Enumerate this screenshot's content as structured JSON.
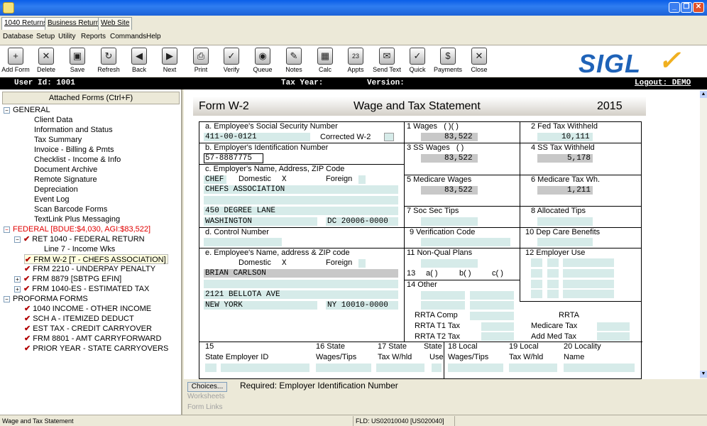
{
  "window": {
    "minimize": "_",
    "restore": "❐",
    "close": "✕"
  },
  "tabs": [
    "1040 Returns",
    "Business Returns",
    "Web Site"
  ],
  "menu": [
    "Database",
    "Setup",
    "Utility",
    "Reports",
    "Commands",
    "Help"
  ],
  "toolbar": [
    {
      "label": "Add Form",
      "icon": "add-form-icon",
      "glyph": "+"
    },
    {
      "label": "Delete",
      "icon": "delete-icon",
      "glyph": "✕"
    },
    {
      "label": "Save",
      "icon": "save-icon",
      "glyph": "▣"
    },
    {
      "label": "Refresh",
      "icon": "refresh-icon",
      "glyph": "↻"
    },
    {
      "label": "Back",
      "icon": "back-icon",
      "glyph": "◀"
    },
    {
      "label": "Next",
      "icon": "next-icon",
      "glyph": "▶"
    },
    {
      "label": "Print",
      "icon": "print-icon",
      "glyph": "⎙"
    },
    {
      "label": "Verify",
      "icon": "verify-icon",
      "glyph": "✓"
    },
    {
      "label": "Queue",
      "icon": "queue-icon",
      "glyph": "◉"
    },
    {
      "label": "Notes",
      "icon": "notes-icon",
      "glyph": "✎"
    },
    {
      "label": "Calc",
      "icon": "calc-icon",
      "glyph": "▦"
    },
    {
      "label": "Appts",
      "icon": "appts-icon",
      "glyph": "23"
    },
    {
      "label": "Send Text",
      "icon": "send-text-icon",
      "glyph": "✉"
    },
    {
      "label": "Quick",
      "icon": "quick-icon",
      "glyph": "✓"
    },
    {
      "label": "Payments",
      "icon": "payments-icon",
      "glyph": "$"
    },
    {
      "label": "Close",
      "icon": "close-form-icon",
      "glyph": "✕"
    }
  ],
  "logo": "SIGL",
  "info": {
    "user": "User Id: 1001",
    "year": "Tax Year:",
    "version": "Version:",
    "logout": "Logout: DEMO"
  },
  "sidebar": {
    "attached": "Attached Forms (Ctrl+F)",
    "general": "GENERAL",
    "general_items": [
      "Client Data",
      "Information and Status",
      "Tax Summary",
      "Invoice - Billing & Pmts",
      "Checklist - Income & Info",
      "Document Archive",
      "Remote Signature",
      "Depreciation",
      "Event Log",
      "Scan Barcode Forms",
      "TextLink Plus Messaging"
    ],
    "federal": "FEDERAL [BDUE:$4,030, AGI:$83,522]",
    "ret": "RET 1040 - FEDERAL RETURN",
    "line7": "Line 7 - Income Wks",
    "forms": [
      "FRM W-2 [T - CHEFS ASSOCIATION]",
      "FRM 2210 - UNDERPAY PENALTY",
      "FRM 8879 [SBTPG EFIN]",
      "FRM 1040-ES - ESTIMATED TAX"
    ],
    "proforma": "PROFORMA FORMS",
    "proforma_items": [
      "1040 INCOME - OTHER INCOME",
      "SCH A - ITEMIZED DEDUCT",
      "EST TAX - CREDIT CARRYOVER",
      "FRM 8801 - AMT CARRYFORWARD",
      "PRIOR YEAR - STATE CARRYOVERS"
    ]
  },
  "form": {
    "name": "Form W-2",
    "title": "Wage and Tax Statement",
    "year": "2015",
    "a_label": "a. Employee's Social Security Number",
    "ssn": "411-00-0121",
    "corrected": "Corrected W-2",
    "b_label": "b. Employer's Identification Number",
    "ein": "57-8887775",
    "c_label": "c. Employer's Name, Address, ZIP Code",
    "c_code": "CHEF",
    "domestic": "Domestic",
    "x": "X",
    "foreign": "Foreign",
    "c_name": "CHEFS ASSOCIATION",
    "c_addr": "450 DEGREE LANE",
    "c_city": "WASHINGTON",
    "c_statezip": "DC 20006-0000",
    "d_label": "d. Control Number",
    "e_label": "e. Employee's Name, address & ZIP code",
    "e_name": "BRIAN CARLSON",
    "e_addr": "2121 BELLOTA AVE",
    "e_city": "NEW YORK",
    "e_statezip": "NY 10010-0000",
    "box1": "1 Wages",
    "box1_paren": "(  )(  )",
    "box1_val": "83,522",
    "box2": "2 Fed Tax Withheld",
    "box2_val": "10,111",
    "box3": "3 SS Wages",
    "box3_paren": "(   )",
    "box3_val": "83,522",
    "box4": "4 SS Tax Withheld",
    "box4_val": "5,178",
    "box5": "5 Medicare Wages",
    "box5_val": "83,522",
    "box6": "6 Medicare Tax Wh.",
    "box6_val": "1,211",
    "box7": "7 Soc Sec Tips",
    "box8": "8 Allocated Tips",
    "box9": "9 Verification Code",
    "box10": "10 Dep Care Benefits",
    "box11": "11 Non-Qual Plans",
    "box12": "12 Employer Use",
    "box13": "13",
    "box13a": "a(  )",
    "box13b": "b(  )",
    "box13c": "c(  )",
    "box14": "14 Other",
    "rrta_comp": "RRTA Comp",
    "rrta_t1": "RRTA T1 Tax",
    "rrta_t2": "RRTA T2 Tax",
    "rrta": "RRTA",
    "medicare_tax": "Medicare Tax",
    "add_med": "Add Med Tax",
    "box15": "15",
    "state_emp": "State Employer ID",
    "box16": "16 State",
    "box16b": "Wages/Tips",
    "box17": "17 State",
    "box17b": "Tax W/hld",
    "state_use": "State",
    "state_use2": "Use",
    "box18": "18 Local",
    "box18b": "Wages/Tips",
    "box19": "19 Local",
    "box19b": "Tax W/hld",
    "box20": "20 Locality",
    "box20b": "Name"
  },
  "bottom": {
    "choices": "Choices...",
    "worksheets": "Worksheets",
    "formlinks": "Form Links",
    "required": "Required: Employer Identification Number"
  },
  "status": {
    "left": "Wage and Tax Statement",
    "fld": "FLD: US02010040  [US020040]"
  }
}
